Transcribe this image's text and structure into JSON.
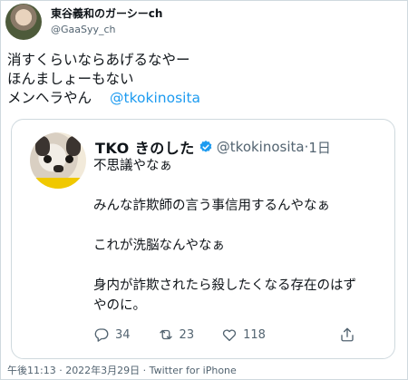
{
  "author": {
    "name": "東谷義和のガーシーch",
    "handle": "@GaaSyy_ch",
    "avatar_icon": "profile-photo"
  },
  "tweet": {
    "lines": [
      "消すくらいならあげるなやー",
      "ほんましょーもない",
      "メンヘラやん"
    ],
    "mention": "@tkokinosita"
  },
  "quote": {
    "name": "TKO きのした",
    "handle": "@tkokinosita",
    "separator": "·",
    "time": "1日",
    "verified_icon": "verified-badge-icon",
    "lines": [
      "不思議やなぁ",
      "",
      "みんな詐欺師の言う事信用するんやなぁ",
      "",
      "これが洗脳なんやなぁ",
      "",
      "身内が詐欺されたら殺したくなる存在のはず",
      "やのに。"
    ],
    "stats": {
      "replies": "34",
      "retweets": "23",
      "likes": "118"
    }
  },
  "footer": "午後11:13 · 2022年3月29日 · Twitter for iPhone",
  "colors": {
    "accent": "#1d9bf0",
    "muted": "#536471",
    "border": "#cfd9de"
  }
}
